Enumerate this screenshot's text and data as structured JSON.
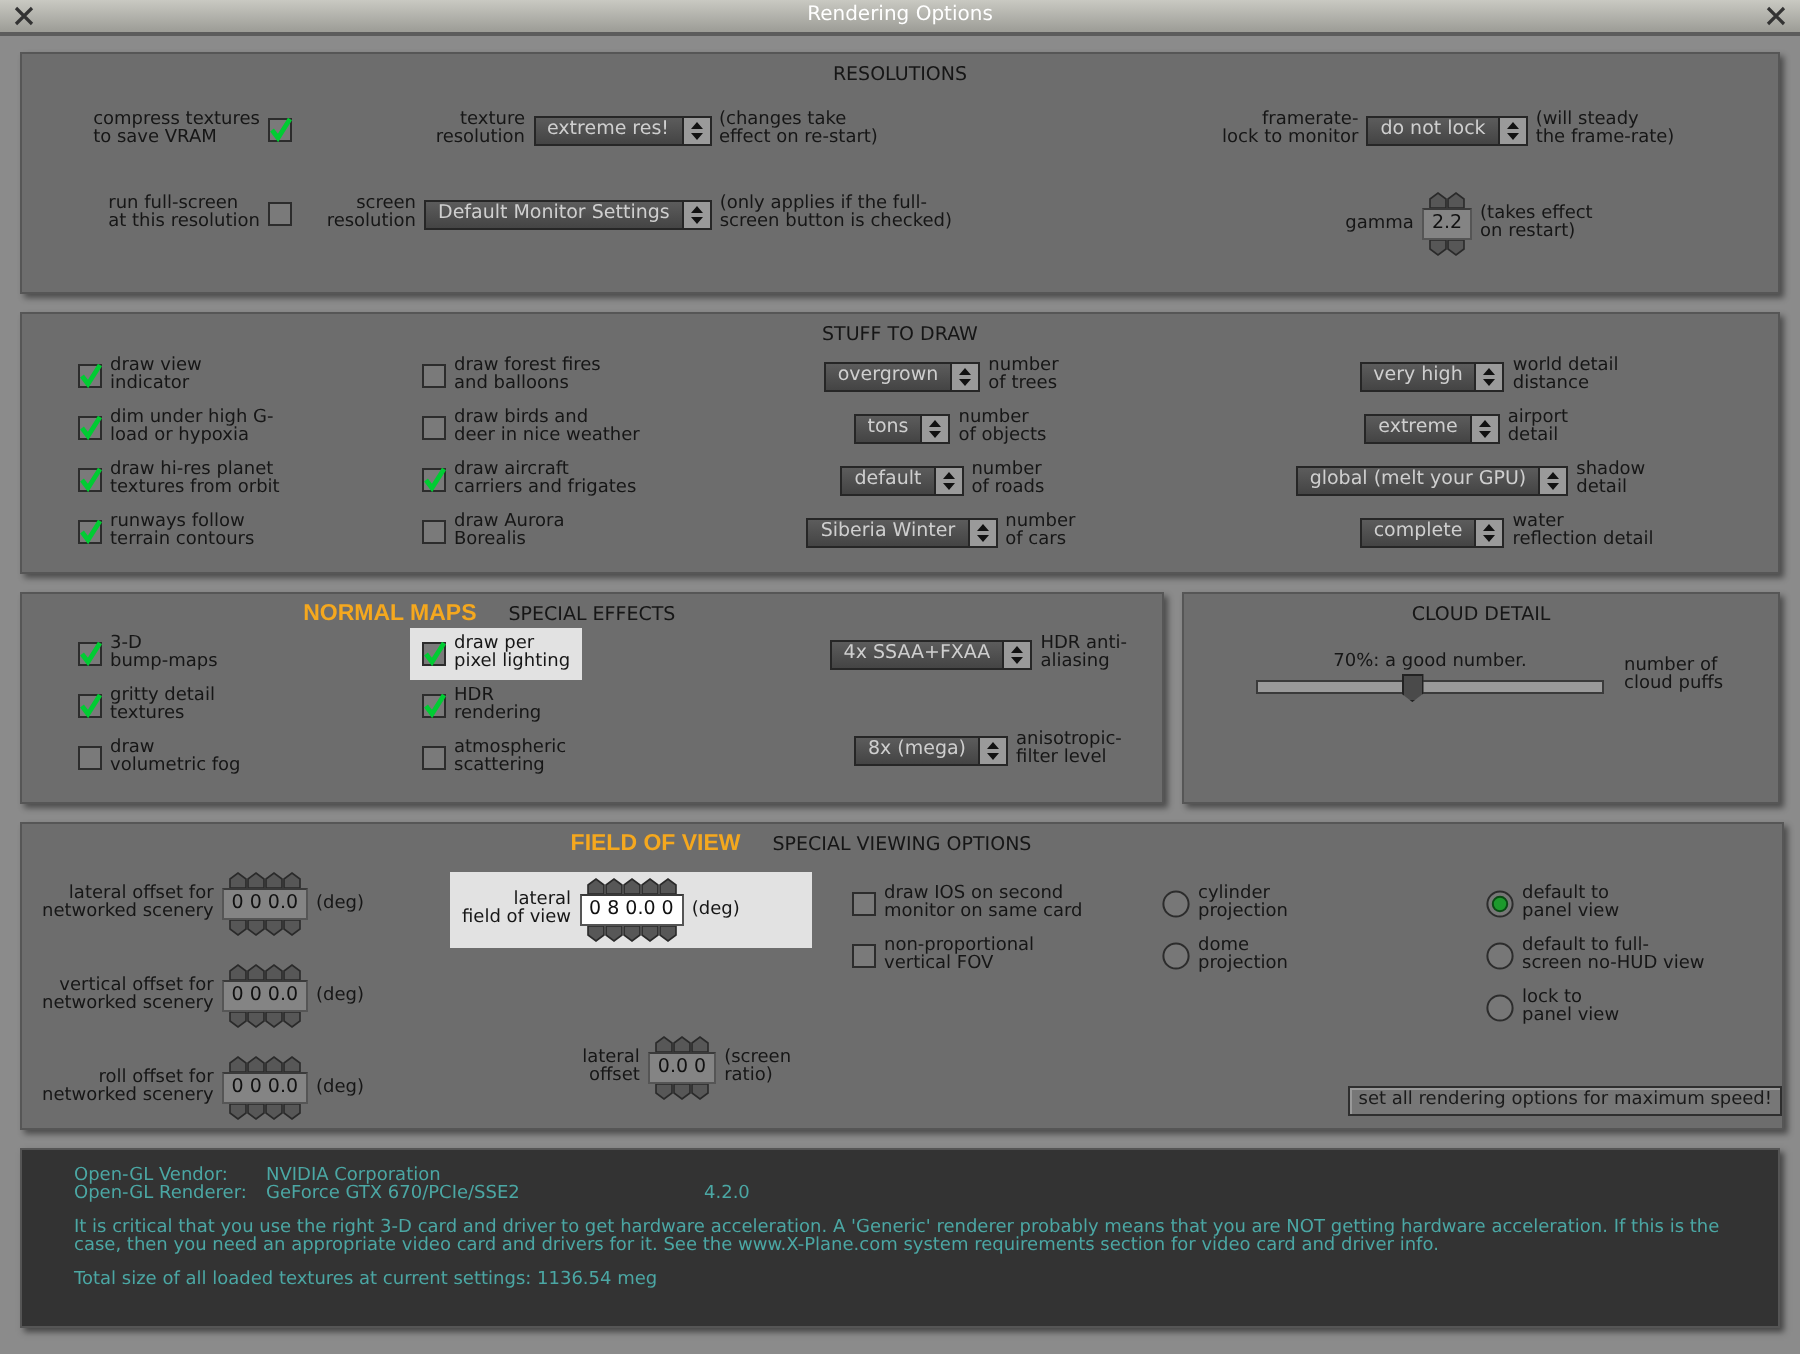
{
  "window": {
    "title": "Rendering Options"
  },
  "resolutions": {
    "title": "RESOLUTIONS",
    "columns": [
      [
        {
          "kind": "checkbox-left",
          "label": "compress textures\nto save VRAM",
          "checked": true
        },
        {
          "kind": "checkbox-left",
          "label": "run full-screen\nat this resolution",
          "checked": false
        }
      ],
      [
        {
          "kind": "dropdown",
          "label": "texture\nresolution",
          "value": "extreme res!",
          "caption": "(changes take\neffect on re-start)"
        },
        {
          "kind": "dropdown",
          "label": "screen\nresolution",
          "value": "Default Monitor Settings",
          "caption": "(only applies if the full-\nscreen button is checked)"
        }
      ],
      [
        {
          "kind": "dropdown",
          "label": "framerate-\nlock to monitor",
          "value": "do not lock",
          "caption": "(will steady\nthe frame-rate)"
        },
        {
          "kind": "spinner",
          "label": "gamma",
          "value": "2.2",
          "caption": "(takes effect\non restart)"
        }
      ]
    ]
  },
  "stuff_to_draw": {
    "title": "STUFF TO DRAW",
    "columns": [
      [
        {
          "kind": "checkbox",
          "label": "draw view\nindicator",
          "checked": true
        },
        {
          "kind": "checkbox",
          "label": "dim under high G-\nload or hypoxia",
          "checked": true
        },
        {
          "kind": "checkbox",
          "label": "draw hi-res planet\ntextures from orbit",
          "checked": true
        },
        {
          "kind": "checkbox",
          "label": "runways follow\nterrain contours",
          "checked": true
        }
      ],
      [
        {
          "kind": "checkbox",
          "label": "draw forest fires\nand balloons",
          "checked": false
        },
        {
          "kind": "checkbox",
          "label": "draw birds and\ndeer in nice weather",
          "checked": false
        },
        {
          "kind": "checkbox",
          "label": "draw aircraft\ncarriers and frigates",
          "checked": true
        },
        {
          "kind": "checkbox",
          "label": "draw Aurora\nBorealis",
          "checked": false
        }
      ],
      [
        {
          "kind": "dropdown",
          "value": "overgrown",
          "caption": "number\nof trees"
        },
        {
          "kind": "dropdown",
          "value": "tons",
          "caption": "number\nof objects"
        },
        {
          "kind": "dropdown",
          "value": "default",
          "caption": "number\nof roads"
        },
        {
          "kind": "dropdown",
          "value": "Siberia Winter",
          "caption": "number\nof cars"
        }
      ],
      [
        {
          "kind": "dropdown",
          "value": "very high",
          "caption": "world detail\ndistance"
        },
        {
          "kind": "dropdown",
          "value": "extreme",
          "caption": "airport\ndetail"
        },
        {
          "kind": "dropdown",
          "value": "global (melt your GPU)",
          "caption": "shadow\ndetail"
        },
        {
          "kind": "dropdown",
          "value": "complete",
          "caption": "water\nreflection detail"
        }
      ]
    ]
  },
  "special_effects": {
    "title": "SPECIAL EFFECTS",
    "callout": "NORMAL MAPS",
    "columns": [
      [
        {
          "kind": "checkbox",
          "label": "3-D\nbump-maps",
          "checked": true
        },
        {
          "kind": "checkbox",
          "label": "gritty detail\ntextures",
          "checked": true
        },
        {
          "kind": "checkbox",
          "label": "draw\nvolumetric fog",
          "checked": false
        }
      ],
      [
        {
          "kind": "checkbox",
          "label": "draw per\npixel lighting",
          "checked": true,
          "highlighted": true
        },
        {
          "kind": "checkbox",
          "label": "HDR\nrendering",
          "checked": true
        },
        {
          "kind": "checkbox",
          "label": "atmospheric\nscattering",
          "checked": false
        }
      ],
      [
        {
          "kind": "dropdown",
          "value": "4x SSAA+FXAA",
          "caption": "HDR anti-\naliasing"
        },
        {
          "kind": "dropdown",
          "value": "8x (mega)",
          "caption": "anisotropic-\nfilter level"
        }
      ]
    ]
  },
  "cloud_detail": {
    "title": "CLOUD DETAIL",
    "columns": [
      [
        {
          "kind": "slider",
          "reading": "70%: a good number.",
          "level": 0.44,
          "caption": "number of\ncloud puffs"
        }
      ]
    ]
  },
  "special_viewing": {
    "title": "SPECIAL VIEWING OPTIONS",
    "callout": "FIELD OF VIEW",
    "columns": [
      [
        {
          "kind": "spinner",
          "label": "lateral offset for\nnetworked scenery",
          "value": "0 0 0.0",
          "caption": "(deg)"
        },
        {
          "kind": "spinner",
          "label": "vertical offset for\nnetworked scenery",
          "value": "0 0 0.0",
          "caption": "(deg)"
        },
        {
          "kind": "spinner",
          "label": "roll offset for\nnetworked scenery",
          "value": "0 0 0.0",
          "caption": "(deg)"
        }
      ],
      [
        {
          "kind": "spinner",
          "label": "lateral\nfield of view",
          "value": "0 8 0.0 0",
          "caption": "(deg)",
          "highlighted": true
        },
        {
          "kind": "spinner",
          "label": "lateral\noffset",
          "value": "0.0 0",
          "caption": "(screen\nratio)"
        }
      ],
      [
        {
          "kind": "checkbox",
          "label": "draw IOS on second\nmonitor on same card",
          "checked": false
        },
        {
          "kind": "checkbox",
          "label": "non-proportional\nvertical FOV",
          "checked": false
        }
      ],
      [
        {
          "kind": "radio",
          "label": "cylinder\nprojection",
          "selected": false
        },
        {
          "kind": "radio",
          "label": "dome\nprojection",
          "selected": false
        }
      ],
      [
        {
          "kind": "radio",
          "label": "default to\npanel view",
          "selected": true
        },
        {
          "kind": "radio",
          "label": "default to full-\nscreen no-HUD view",
          "selected": false
        },
        {
          "kind": "radio",
          "label": "lock to\npanel view",
          "selected": false
        },
        {
          "kind": "button",
          "label": "set all rendering options for maximum speed!"
        }
      ]
    ]
  },
  "renderer_info": {
    "rows": [
      {
        "label": "Open-GL Vendor:",
        "value": "NVIDIA Corporation"
      },
      {
        "label": "Open-GL Renderer:",
        "value": "GeForce GTX 670/PCIe/SSE2",
        "version": "4.2.0"
      }
    ],
    "notice": "It is critical that you use the right 3-D card and driver to get hardware acceleration. A 'Generic' renderer probably means that you are NOT getting hardware acceleration. If this is the case, then you need an appropriate video card and drivers for it. See the www.X-Plane.com system requirements section for video card and driver info.",
    "texture_total": "Total size of all loaded textures at current settings: 1136.54 meg"
  }
}
